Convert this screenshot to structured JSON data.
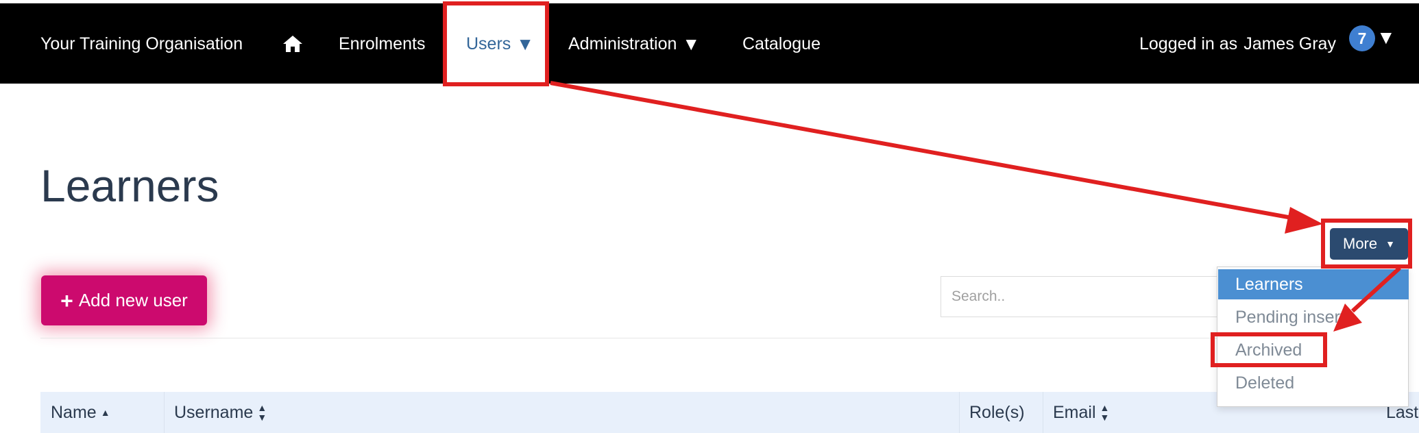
{
  "nav": {
    "brand": "Your Training Organisation",
    "home_icon": "home-icon",
    "items": [
      {
        "label": "Enrolments"
      },
      {
        "label": "Users",
        "caret": "▼",
        "active": true
      },
      {
        "label": "Administration",
        "caret": "▼"
      },
      {
        "label": "Catalogue"
      }
    ],
    "logged_in_label": "Logged in as",
    "user_name": "James Gray",
    "notification_count": "7",
    "user_caret": "▼"
  },
  "page": {
    "title": "Learners"
  },
  "toolbar": {
    "add_user_label": "Add new user",
    "add_user_icon": "plus-icon",
    "search_placeholder": "Search..",
    "more_label": "More"
  },
  "more_menu": {
    "items": [
      {
        "label": "Learners",
        "selected": true
      },
      {
        "label": "Pending insert"
      },
      {
        "label": "Archived"
      },
      {
        "label": "Deleted"
      }
    ]
  },
  "table": {
    "columns": [
      {
        "label": "Name",
        "sort": "ascending"
      },
      {
        "label": "Username",
        "sort": "sortable"
      },
      {
        "label": "Role(s)",
        "sort": "none"
      },
      {
        "label": "Email",
        "sort": "sortable"
      },
      {
        "label": "Last",
        "sort": "none"
      }
    ]
  },
  "colors": {
    "nav_background": "#000000",
    "active_nav_text": "#336699",
    "add_button": "#cc0a6e",
    "more_button": "#2b4a6f",
    "menu_selected": "#4b8fd2",
    "table_header": "#e8f0fb",
    "annotation": "#e02020",
    "badge": "#3f7fd1"
  }
}
